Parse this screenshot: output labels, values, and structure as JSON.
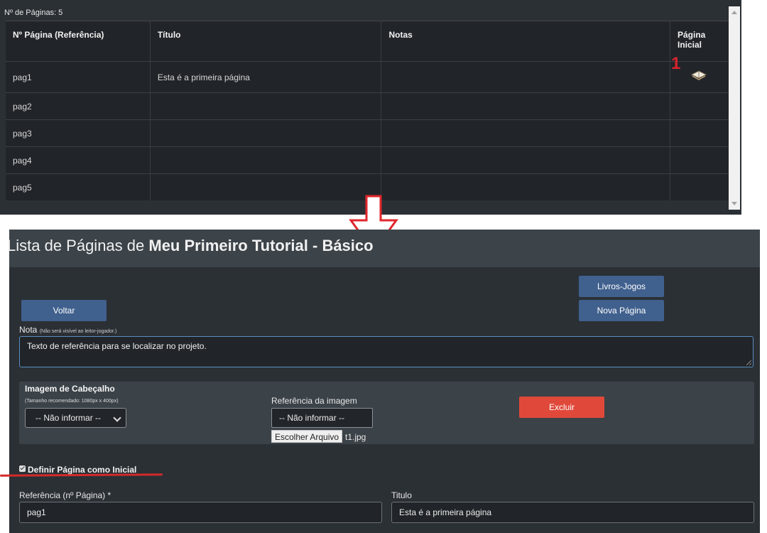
{
  "page_list": {
    "count_label": "Nº de Páginas: 5",
    "columns": [
      "Nº Página (Referência)",
      "Título",
      "Notas",
      "Página Inicial"
    ],
    "rows": [
      {
        "ref": "pag1",
        "title": "Esta é a primeira página",
        "notes": "",
        "start": true
      },
      {
        "ref": "pag2",
        "title": "",
        "notes": "",
        "start": false
      },
      {
        "ref": "pag3",
        "title": "",
        "notes": "",
        "start": false
      },
      {
        "ref": "pag4",
        "title": "",
        "notes": "",
        "start": false
      },
      {
        "ref": "pag5",
        "title": "",
        "notes": "",
        "start": false
      }
    ],
    "marker": "1"
  },
  "editor": {
    "title_prefix": "Lista de Páginas de ",
    "title_bold": "Meu Primeiro Tutorial - Básico",
    "buttons": {
      "back": "Voltar",
      "books": "Livros-Jogos",
      "new_page": "Nova Página",
      "delete": "Excluir"
    },
    "note": {
      "label": "Nota",
      "hint": "(Não será visível ao leitor-jogador.)",
      "value": "Texto de referência para se localizar no projeto."
    },
    "header_image": {
      "title": "Imagem de Cabeçalho",
      "hint": "(Tamanho recomendado: 1080px x 400px)",
      "select_value": "-- Não informar --",
      "ref_label": "Referência da imagem",
      "ref_value": "-- Não informar --",
      "file_button": "Escolher Arquivo",
      "file_name": "t1.jpg"
    },
    "start_checkbox": {
      "label": "Definir Página como Inicial",
      "checked": true
    },
    "reference": {
      "label": "Referência (nº Página) *",
      "value": "pag1"
    },
    "titulo": {
      "label": "Titulo",
      "value": "Esta é a primeira página"
    }
  },
  "colors": {
    "accent_blue": "#40608e",
    "danger": "#e0493a",
    "annotation_red": "#d9232c"
  }
}
